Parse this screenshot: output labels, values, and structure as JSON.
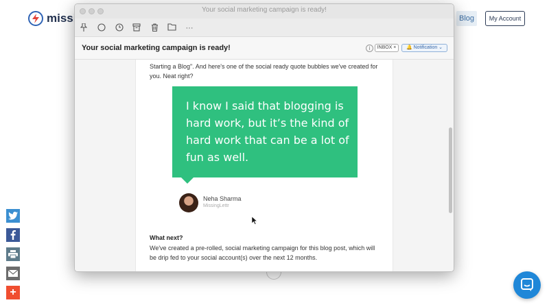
{
  "site": {
    "logo_text": "missing",
    "nav_blog": "Blog",
    "nav_account": "My Account",
    "share_icons": [
      "twitter-icon",
      "facebook-icon",
      "print-icon",
      "email-icon",
      "plus-icon"
    ],
    "chat_icon": "chat-icon"
  },
  "window": {
    "title": "Your social marketing campaign is ready!",
    "toolbar_icons": [
      "pin-icon",
      "circle-icon",
      "clock-icon",
      "archive-icon",
      "trash-icon",
      "folder-icon",
      "more-icon"
    ],
    "more_label": "···"
  },
  "email": {
    "subject": "Your social marketing campaign is ready!",
    "info_label": "i",
    "inbox_tag": "INBOX ×",
    "notification_tag": "🔔 Notification ⌄",
    "intro": "Starting a Blog\". And here's one of the social ready quote bubbles we've created for you. Neat right?",
    "quote": "I know I said that blogging is hard work, but it’s the kind of hard work that can be a lot of fun as well.",
    "author_name": "Neha Sharma",
    "author_handle": "MissingLettr",
    "next_title": "What next?",
    "next_body": "We've created a pre-rolled, social marketing campaign for this blog post, which will be drip fed to your social account(s) over the next 12 months."
  },
  "colors": {
    "quote_green": "#2fc07f",
    "brand_blue": "#2f63b5",
    "twitter": "#3b8fd1",
    "facebook": "#3b5998",
    "share_plus": "#f04e30"
  }
}
